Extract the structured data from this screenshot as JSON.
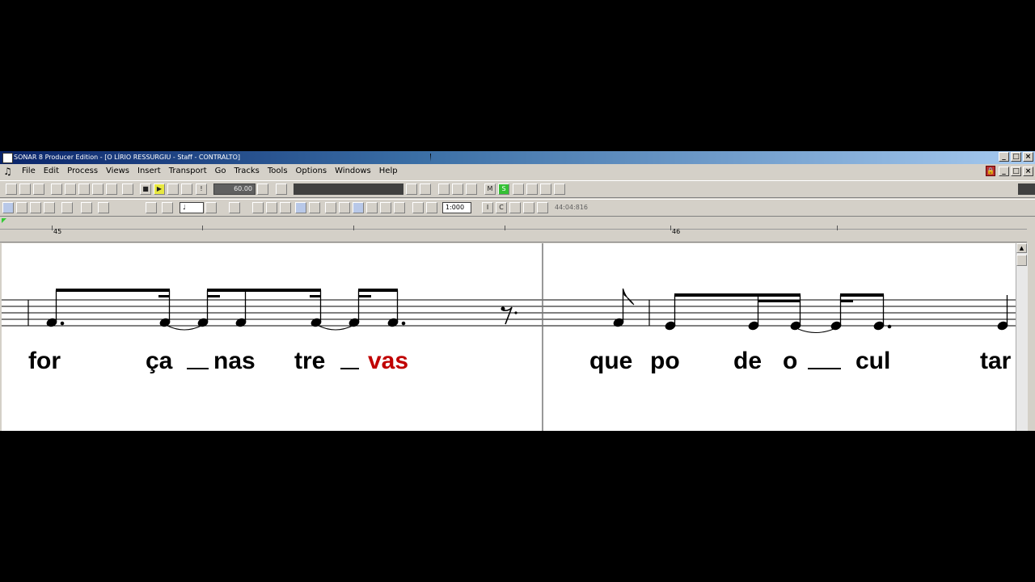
{
  "window": {
    "title": "SONAR 8 Producer Edition - [O LÍRIO RESSURGIU - Staff - CONTRALTO]",
    "controls": [
      "_",
      "□",
      "×"
    ]
  },
  "menu": {
    "items": [
      "File",
      "Edit",
      "Process",
      "Views",
      "Insert",
      "Transport",
      "Go",
      "Tracks",
      "Tools",
      "Options",
      "Windows",
      "Help"
    ]
  },
  "toolbar": {
    "tempo": "60.00",
    "snap_value": "1:000",
    "timecode": "44:04:816",
    "btn_s": "S",
    "btn_m": "M",
    "btn_i": "I",
    "btn_c": "C"
  },
  "ruler": {
    "measure_a": "45",
    "measure_b": "46"
  },
  "lyrics": [
    {
      "text": "for",
      "color": "#000000"
    },
    {
      "text": "ça",
      "color": "#000000"
    },
    {
      "text": "nas",
      "color": "#000000"
    },
    {
      "text": "tre",
      "color": "#000000"
    },
    {
      "text": "vas",
      "color": "#c00000"
    },
    {
      "text": "que",
      "color": "#000000"
    },
    {
      "text": "po",
      "color": "#000000"
    },
    {
      "text": "de",
      "color": "#000000"
    },
    {
      "text": "o",
      "color": "#000000"
    },
    {
      "text": "cul",
      "color": "#000000"
    },
    {
      "text": "tar",
      "color": "#000000"
    }
  ]
}
